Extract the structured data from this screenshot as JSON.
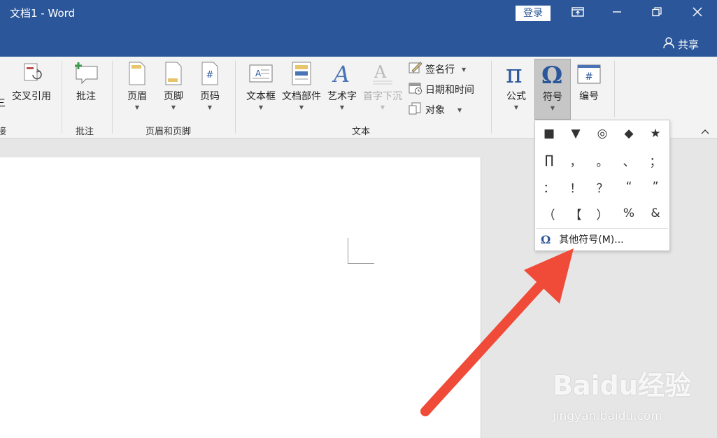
{
  "window": {
    "title": "文档1  -  Word",
    "login_label": "登录",
    "share_label": "共享"
  },
  "ribbon": {
    "partial_left_label": "接",
    "buttons": {
      "cross_reference": "交叉引用",
      "comment": "批注",
      "header": "页眉",
      "footer": "页脚",
      "page_number": "页码",
      "text_box": "文本框",
      "quick_parts": "文档部件",
      "wordart": "艺术字",
      "drop_cap": "首字下沉",
      "signature_line": "签名行",
      "date_time": "日期和时间",
      "object": "对象",
      "equation": "公式",
      "symbol": "符号",
      "numbering": "编号"
    },
    "groups": {
      "links": "接",
      "comments": "批注",
      "header_footer": "页眉和页脚",
      "text": "文本"
    }
  },
  "symbol_dropdown": {
    "symbols": [
      "■",
      "▼",
      "◎",
      "◆",
      "★",
      "∏",
      "，",
      "。",
      "、",
      "；",
      "：",
      "！",
      "？",
      "“",
      "”",
      "（",
      "【",
      "）",
      "%",
      "&"
    ],
    "more_symbols_label": "其他符号(M)..."
  },
  "watermark": {
    "brand": "Baidu经验",
    "url": "jingyan.baidu.com"
  },
  "colors": {
    "titlebar": "#2b579a",
    "ribbon": "#f3f3f3",
    "arrow": "#f04a38"
  }
}
